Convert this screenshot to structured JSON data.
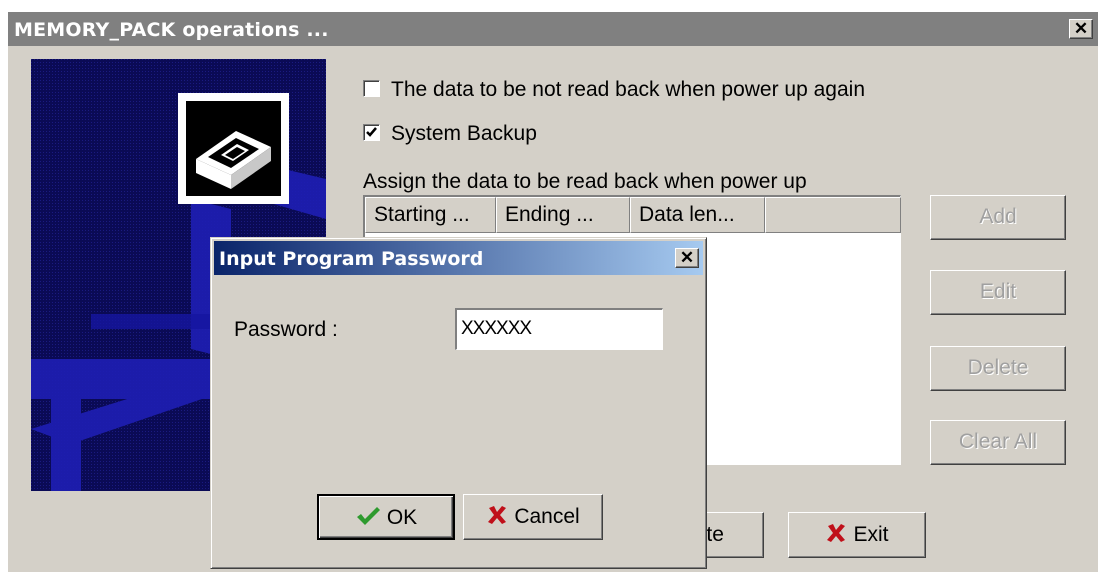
{
  "window": {
    "title": "MEMORY_PACK operations ...",
    "close_glyph": "✕"
  },
  "options": {
    "no_readback_label": "The data to be not read back when power up again",
    "no_readback_checked": false,
    "system_backup_label": "System Backup",
    "system_backup_checked": true
  },
  "assign": {
    "label": "Assign the data to be read back when power up",
    "columns": [
      "Starting ...",
      "Ending ...",
      "Data len..."
    ],
    "rows": []
  },
  "side_buttons": {
    "add": "Add",
    "edit": "Edit",
    "delete": "Delete",
    "clear_all": "Clear All"
  },
  "bottom_buttons": {
    "execute": "Execute",
    "exit": "Exit"
  },
  "password_dialog": {
    "title": "Input Program Password",
    "close_glyph": "✕",
    "password_label": "Password :",
    "password_value": "XXXXXX",
    "ok_label": "OK",
    "cancel_label": "Cancel"
  },
  "colors": {
    "dialog_face": "#d4d0c8",
    "active_title": "#0a246a",
    "inactive_title": "#808080",
    "logo_background": "#0a0a55",
    "ok_check": "#2e9a2e",
    "cancel_x": "#c0101a"
  }
}
